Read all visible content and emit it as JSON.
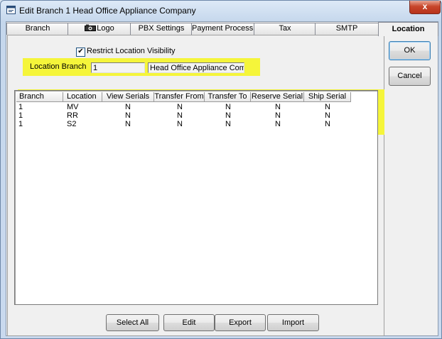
{
  "window": {
    "title": "Edit Branch 1 Head Office Appliance Company",
    "close_glyph": "x"
  },
  "tabs": [
    {
      "label": "Branch"
    },
    {
      "label": "Logo"
    },
    {
      "label": "PBX Settings"
    },
    {
      "label": "Payment Processing"
    },
    {
      "label": "Tax"
    },
    {
      "label": "SMTP"
    },
    {
      "label": "Location",
      "active": true
    }
  ],
  "location": {
    "restrict_checkbox": {
      "label": "Restrict Location Visibility",
      "checked": true,
      "glyph": "✔"
    },
    "branch_label": "Location Branch",
    "branch_value": "1",
    "branch_name": "Head Office Appliance Compa"
  },
  "grid": {
    "columns": [
      "Branch",
      "Location",
      "View Serials",
      "Transfer From",
      "Transfer To",
      "Reserve Serial",
      "Ship Serial"
    ],
    "rows": [
      [
        "1",
        "MV",
        "N",
        "N",
        "N",
        "N",
        "N"
      ],
      [
        "1",
        "RR",
        "N",
        "N",
        "N",
        "N",
        "N"
      ],
      [
        "1",
        "S2",
        "N",
        "N",
        "N",
        "N",
        "N"
      ]
    ]
  },
  "buttons": {
    "select_all": "Select All",
    "edit": "Edit",
    "export": "Export",
    "import": "Import",
    "ok": "OK",
    "cancel": "Cancel"
  },
  "highlight_color": "#f5f53a"
}
